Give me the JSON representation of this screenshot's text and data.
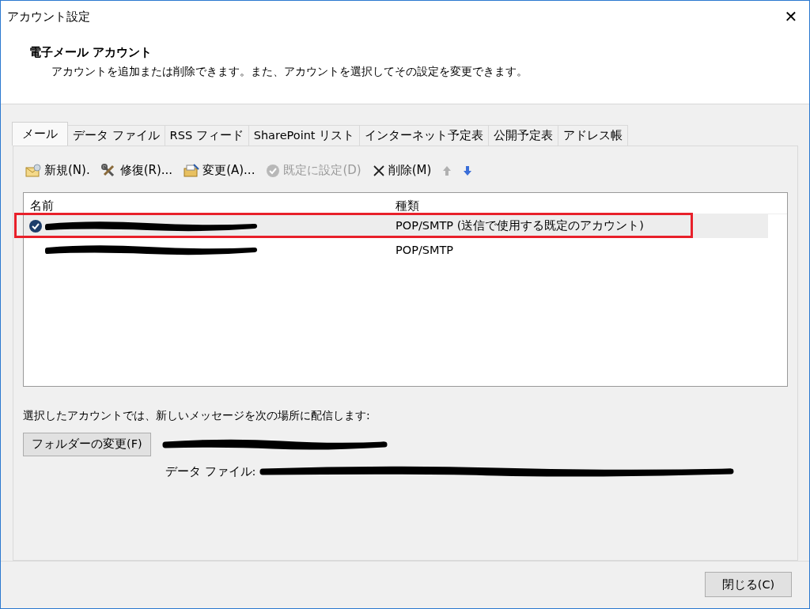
{
  "window": {
    "title": "アカウント設定",
    "close": "✕"
  },
  "header": {
    "title": "電子メール アカウント",
    "description": "アカウントを追加または削除できます。また、アカウントを選択してその設定を変更できます。"
  },
  "tabs": [
    {
      "label": "メール",
      "selected": true
    },
    {
      "label": "データ ファイル",
      "selected": false
    },
    {
      "label": "RSS フィード",
      "selected": false
    },
    {
      "label": "SharePoint リスト",
      "selected": false
    },
    {
      "label": "インターネット予定表",
      "selected": false
    },
    {
      "label": "公開予定表",
      "selected": false
    },
    {
      "label": "アドレス帳",
      "selected": false
    }
  ],
  "toolbar": [
    {
      "kind": "new",
      "label": "新規(N).",
      "disabled": false
    },
    {
      "kind": "repair",
      "label": "修復(R)...",
      "disabled": false
    },
    {
      "kind": "change",
      "label": "変更(A)...",
      "disabled": false
    },
    {
      "kind": "default",
      "label": "既定に設定(D)",
      "disabled": true
    },
    {
      "kind": "delete",
      "label": "削除(M)",
      "disabled": false
    },
    {
      "kind": "up",
      "disabled": true
    },
    {
      "kind": "down",
      "disabled": false
    }
  ],
  "table": {
    "columns": [
      "名前",
      "種類"
    ],
    "rows": [
      {
        "type": "POP/SMTP (送信で使用する既定のアカウント)",
        "selected": true,
        "default": true,
        "highlighted": true
      },
      {
        "type": "POP/SMTP",
        "selected": false,
        "default": false,
        "highlighted": false
      }
    ]
  },
  "delivery": {
    "text": "選択したアカウントでは、新しいメッセージを次の場所に配信します:",
    "button": "フォルダーの変更(F)",
    "data_file_label": "データ ファイル:"
  },
  "footer": {
    "close_button": "閉じる(C)"
  }
}
